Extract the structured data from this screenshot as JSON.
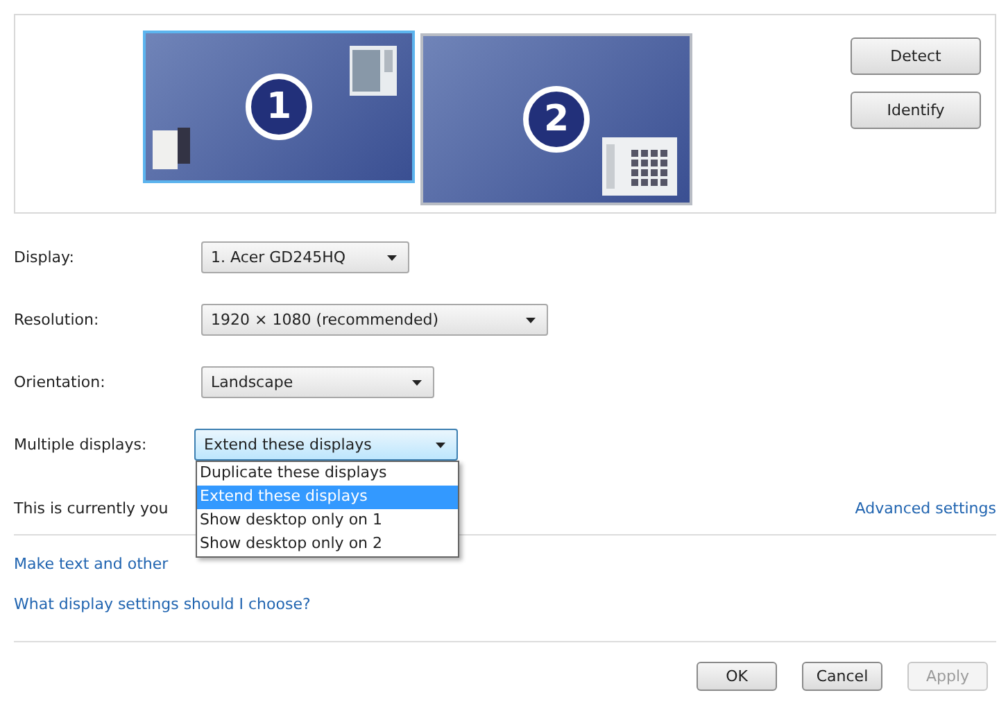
{
  "monitors": [
    {
      "number": "1",
      "selected": true
    },
    {
      "number": "2",
      "selected": false
    }
  ],
  "preview_buttons": [
    "Detect",
    "Identify"
  ],
  "settings": [
    {
      "label": "Display:",
      "value": "1. Acer GD245HQ",
      "focused": false
    },
    {
      "label": "Resolution:",
      "value": "1920 × 1080 (recommended)",
      "focused": false
    },
    {
      "label": "Orientation:",
      "value": "Landscape",
      "focused": false
    },
    {
      "label": "Multiple displays:",
      "value": "Extend these displays",
      "focused": true
    }
  ],
  "dropdown_list": [
    {
      "label": "Duplicate these displays",
      "selected": false
    },
    {
      "label": "Extend these displays",
      "selected": true
    },
    {
      "label": "Show desktop only on 1",
      "selected": false
    },
    {
      "label": "Show desktop only on 2",
      "selected": false
    }
  ],
  "status_text": "This is currently you",
  "advanced_link": "Advanced settings",
  "links": [
    "Make text and other",
    "What display settings should I choose?"
  ],
  "buttons": [
    {
      "label": "OK",
      "disabled": false
    },
    {
      "label": "Cancel",
      "disabled": false
    },
    {
      "label": "Apply",
      "disabled": true
    }
  ]
}
